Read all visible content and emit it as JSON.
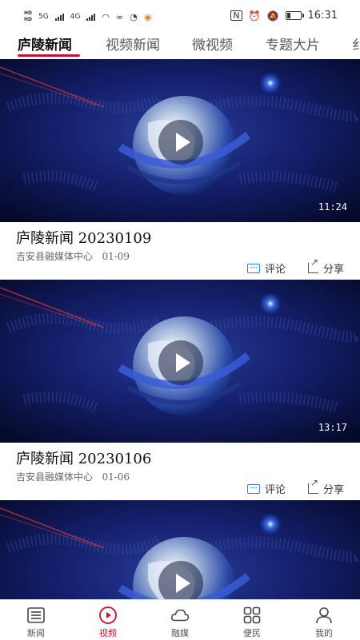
{
  "status_bar": {
    "network_labels": [
      "HD",
      "HD",
      "5G",
      "4G"
    ],
    "time": "16:31"
  },
  "tabs": [
    {
      "label": "庐陵新闻",
      "active": true
    },
    {
      "label": "视频新闻",
      "active": false
    },
    {
      "label": "微视频",
      "active": false
    },
    {
      "label": "专题大片",
      "active": false
    },
    {
      "label": "纟",
      "active": false
    }
  ],
  "feed": [
    {
      "title": "庐陵新闻  20230109",
      "source": "吉安县融媒体中心",
      "date": "01-09",
      "duration": "11:24",
      "comment_label": "评论",
      "share_label": "分享"
    },
    {
      "title": "庐陵新闻  20230106",
      "source": "吉安县融媒体中心",
      "date": "01-06",
      "duration": "13:17",
      "comment_label": "评论",
      "share_label": "分享"
    },
    {
      "title": "",
      "source": "",
      "date": "",
      "duration": "",
      "comment_label": "",
      "share_label": ""
    }
  ],
  "bottom_nav": [
    {
      "label": "新闻",
      "icon": "news-icon",
      "active": false
    },
    {
      "label": "视频",
      "icon": "video-play-icon",
      "active": true
    },
    {
      "label": "融媒",
      "icon": "cloud-icon",
      "active": false
    },
    {
      "label": "便民",
      "icon": "grid-icon",
      "active": false
    },
    {
      "label": "我的",
      "icon": "user-icon",
      "active": false
    }
  ],
  "colors": {
    "accent": "#c8102e",
    "thumb_bg": "#0a1040",
    "comment_icon": "#3a7bd5"
  }
}
